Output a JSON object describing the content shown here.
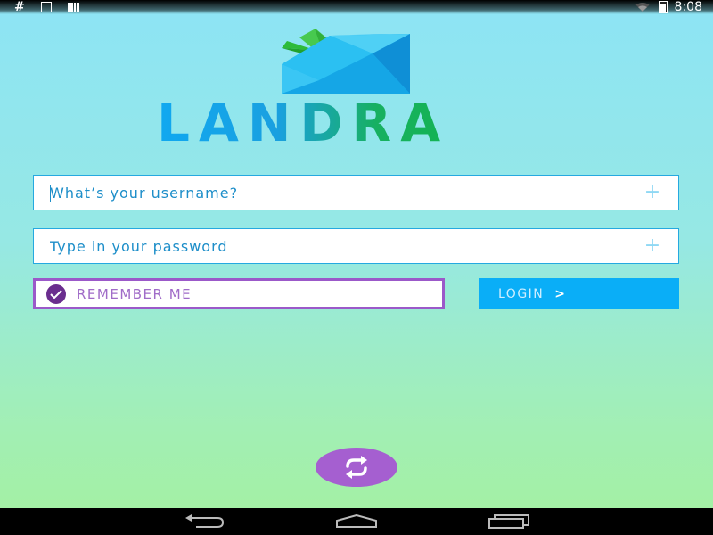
{
  "status_bar": {
    "time": "8:08",
    "left_icons": [
      "hash-icon",
      "download-icon",
      "barcode-icon"
    ],
    "right_icons": [
      "wifi-icon",
      "battery-charging-icon"
    ]
  },
  "logo": {
    "brand_text": "LANDRA",
    "gem_colors": [
      "#1ab4ef",
      "#0f8fd6",
      "#4fd0f5"
    ],
    "leaf_colors": [
      "#2dbb3a",
      "#47c94f"
    ],
    "text_gradient": [
      "#10a8f0",
      "#10b840"
    ]
  },
  "form": {
    "username": {
      "value": "",
      "placeholder": "What’s your username?",
      "icon": "plus-icon"
    },
    "password": {
      "value": "",
      "placeholder": "Type in your password",
      "icon": "plus-icon"
    },
    "remember_me": {
      "label": "REMEMBER ME",
      "checked": true
    },
    "login_button": {
      "label": "LOGIN",
      "arrow": ">"
    }
  },
  "sync_button": {
    "icon": "sync-icon",
    "color": "#a55fd0"
  },
  "nav_bar": {
    "buttons": [
      "back-icon",
      "home-icon",
      "recent-apps-icon"
    ]
  },
  "colors": {
    "accent_blue": "#0aaef7",
    "accent_purple": "#9b59c9",
    "field_text": "#1d8ec9",
    "background_top": "#8de4f5",
    "background_bottom": "#a4f0a0"
  }
}
